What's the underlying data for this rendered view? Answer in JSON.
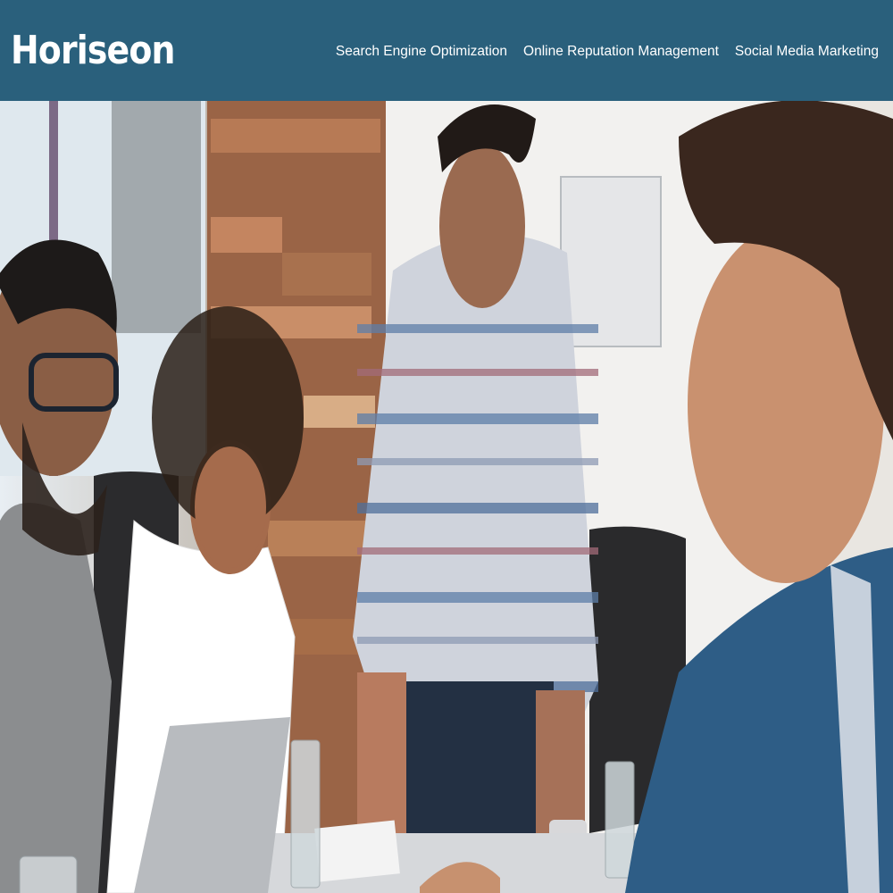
{
  "header": {
    "brand": "Horiseon",
    "nav": [
      {
        "label": "Search Engine Optimization"
      },
      {
        "label": "Online Reputation Management"
      },
      {
        "label": "Social Media Marketing"
      }
    ]
  },
  "colors": {
    "header_bg": "#2a607c",
    "header_text": "#ffffff"
  },
  "hero": {
    "image": "team-meeting-photo"
  }
}
